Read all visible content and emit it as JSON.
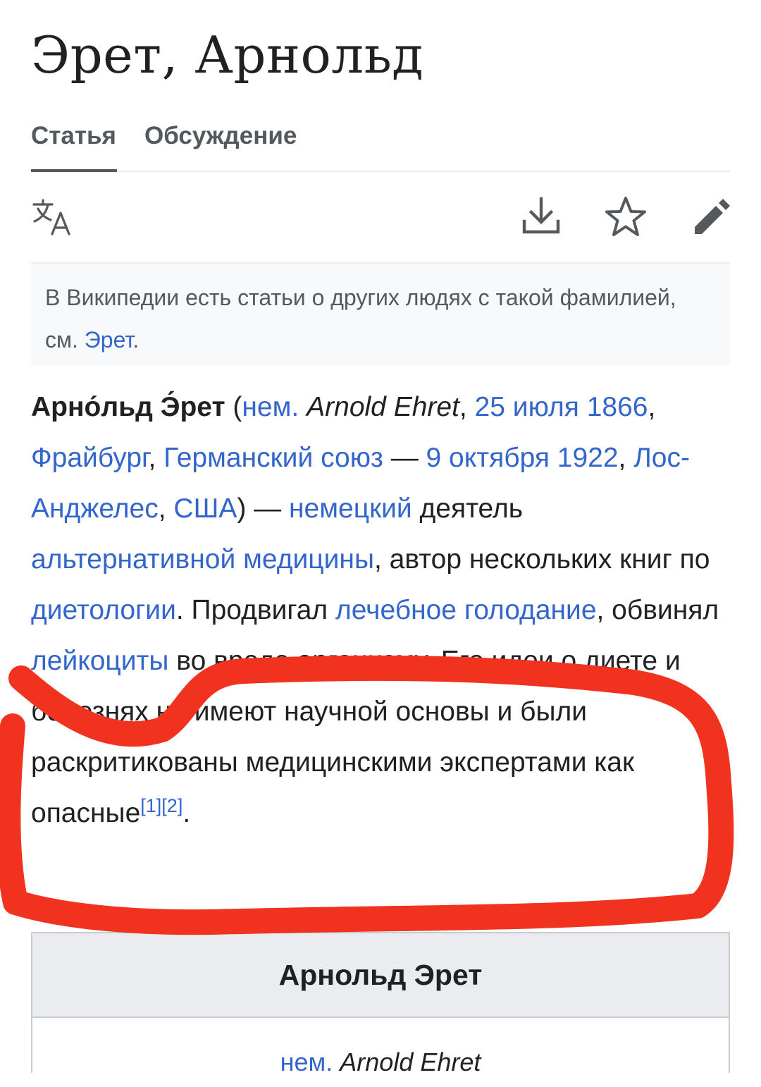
{
  "page": {
    "title": "Эрет, Арнольд"
  },
  "tabs": [
    {
      "label": "Статья",
      "active": true
    },
    {
      "label": "Обсуждение",
      "active": false
    }
  ],
  "toolbar": {
    "icons": [
      "language-icon",
      "download-icon",
      "star-icon",
      "edit-pencil-icon"
    ]
  },
  "hatnote": {
    "text": "В Википедии есть статьи о других людях с такой фамилией, см. ",
    "link": "Эрет",
    "end": "."
  },
  "lead": {
    "name": "Арно́льд Э́рет",
    "open_paren": " (",
    "lang": "нем.",
    "native_name": "Arnold Ehret",
    "c1": ", ",
    "birth_date": "25 июля 1866",
    "c2": ", ",
    "birth_city": "Фрайбург",
    "c3": ", ",
    "birth_country": "Германский союз",
    "dash": " — ",
    "death_date": "9 октября 1922",
    "c4": ", ",
    "death_city": "Лос-Анджелес",
    "c5": ", ",
    "death_country": "США",
    "close_paren": ") — ",
    "nationality": "немецкий",
    "t1": " деятель ",
    "field": "альтернативной медицины",
    "t2": ", автор нескольких книг по ",
    "topic": "диетологии",
    "t3": ". Продвигал ",
    "practice": "лечебное голодание",
    "t4": ", обвинял ",
    "cells": "лейкоциты",
    "t5": " во вреде организму. Его идеи о диете и болезнях не имеют научной основы и были раскритикованы медицинскими экспертами как опасные",
    "ref1": "[1]",
    "ref2": "[2]",
    "end": "."
  },
  "infobox": {
    "title": "Арнольд Эрет",
    "lang": "нем.",
    "native_name": "Arnold Ehret"
  },
  "colors": {
    "link": "#3366cc",
    "annotation": "#f0321e",
    "text": "#202122",
    "muted": "#54595d"
  }
}
